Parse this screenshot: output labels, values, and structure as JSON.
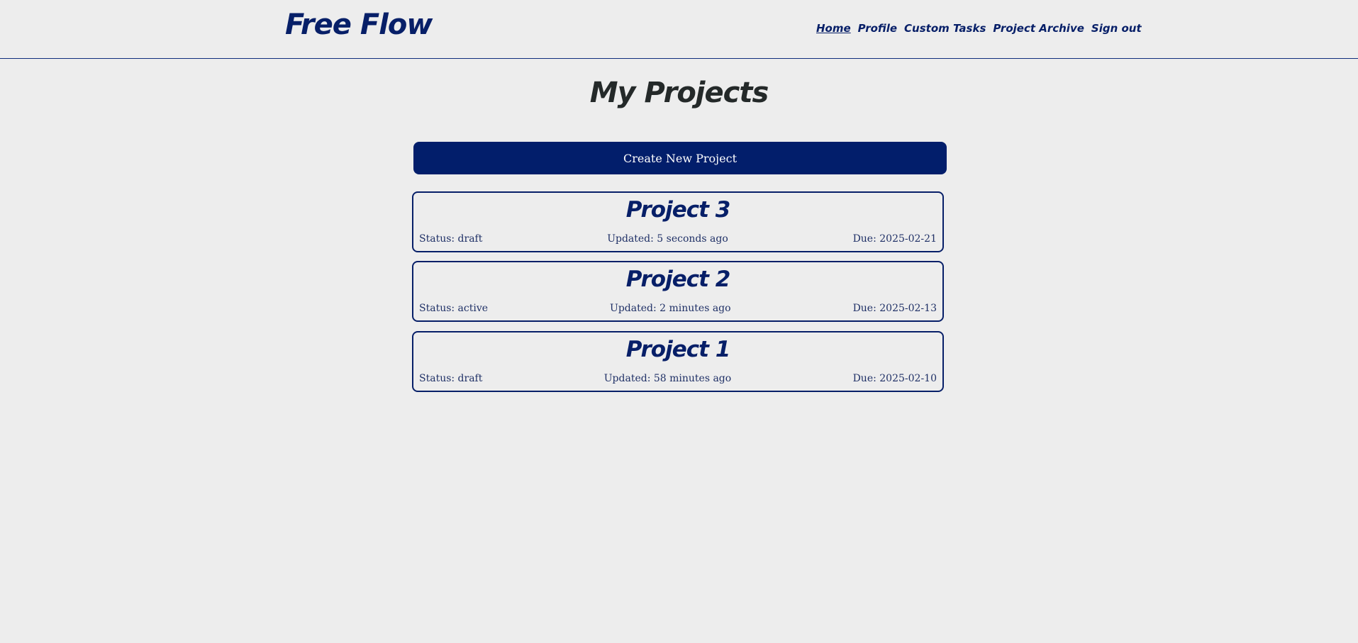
{
  "header": {
    "brand": "Free Flow",
    "nav": [
      "Home",
      "Profile",
      "Custom Tasks",
      "Project Archive",
      "Sign out"
    ]
  },
  "page": {
    "title": "My Projects",
    "create_button": "Create New Project"
  },
  "projects": [
    {
      "title": "Project 3",
      "status": "Status: draft",
      "updated": "Updated: 5 seconds ago",
      "due": "Due: 2025-02-21"
    },
    {
      "title": "Project 2",
      "status": "Status: active",
      "updated": "Updated: 2 minutes ago",
      "due": "Due: 2025-02-13"
    },
    {
      "title": "Project 1",
      "status": "Status: draft",
      "updated": "Updated: 58 minutes ago",
      "due": "Due: 2025-02-10"
    }
  ],
  "colors": {
    "background": "#ededed",
    "primary": "#021e6b",
    "text": "#242929"
  }
}
